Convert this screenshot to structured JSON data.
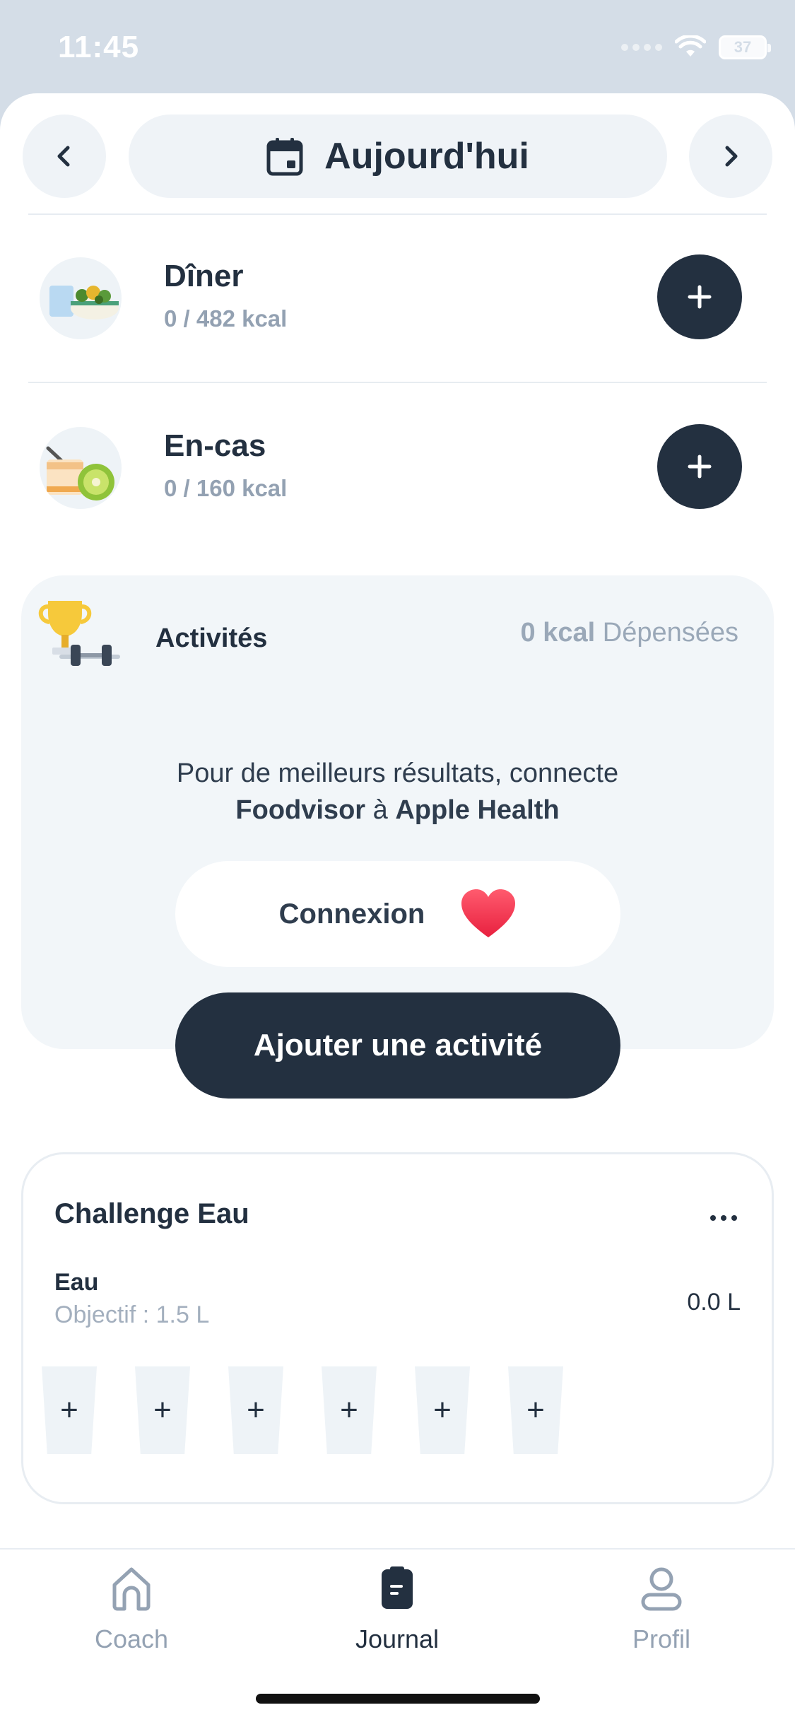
{
  "status_bar": {
    "time": "11:45",
    "battery": "37"
  },
  "date_nav": {
    "label": "Aujourd'hui",
    "prev_icon": "chevron-left-icon",
    "next_icon": "chevron-right-icon",
    "calendar_icon": "calendar-icon"
  },
  "meals": [
    {
      "title": "Dîner",
      "kcal": "0 / 482 kcal",
      "icon": "dinner-plate-icon"
    },
    {
      "title": "En-cas",
      "kcal": "0 / 160 kcal",
      "icon": "snack-kiwi-icon"
    }
  ],
  "activities": {
    "title": "Activités",
    "kcal_value": "0 kcal",
    "kcal_label": "Dépensées",
    "info_line1": "Pour de meilleurs résultats, connecte",
    "info_app": "Foodvisor",
    "info_connector": "à",
    "info_health": "Apple Health",
    "connect_label": "Connexion",
    "add_label": "Ajouter une activité"
  },
  "water": {
    "title": "Challenge Eau",
    "subtitle": "Eau",
    "goal": "Objectif : 1.5 L",
    "value": "0.0 L",
    "glasses": [
      "+",
      "+",
      "+",
      "+",
      "+",
      "+"
    ]
  },
  "tabbar": {
    "tabs": [
      {
        "label": "Coach",
        "icon": "home-icon"
      },
      {
        "label": "Journal",
        "icon": "journal-icon"
      },
      {
        "label": "Profil",
        "icon": "profile-icon"
      }
    ],
    "active": "Journal"
  },
  "colors": {
    "primary": "#233040",
    "muted": "#93a1b2",
    "card_bg": "#f2f6f9",
    "heart": "#f0405a"
  }
}
